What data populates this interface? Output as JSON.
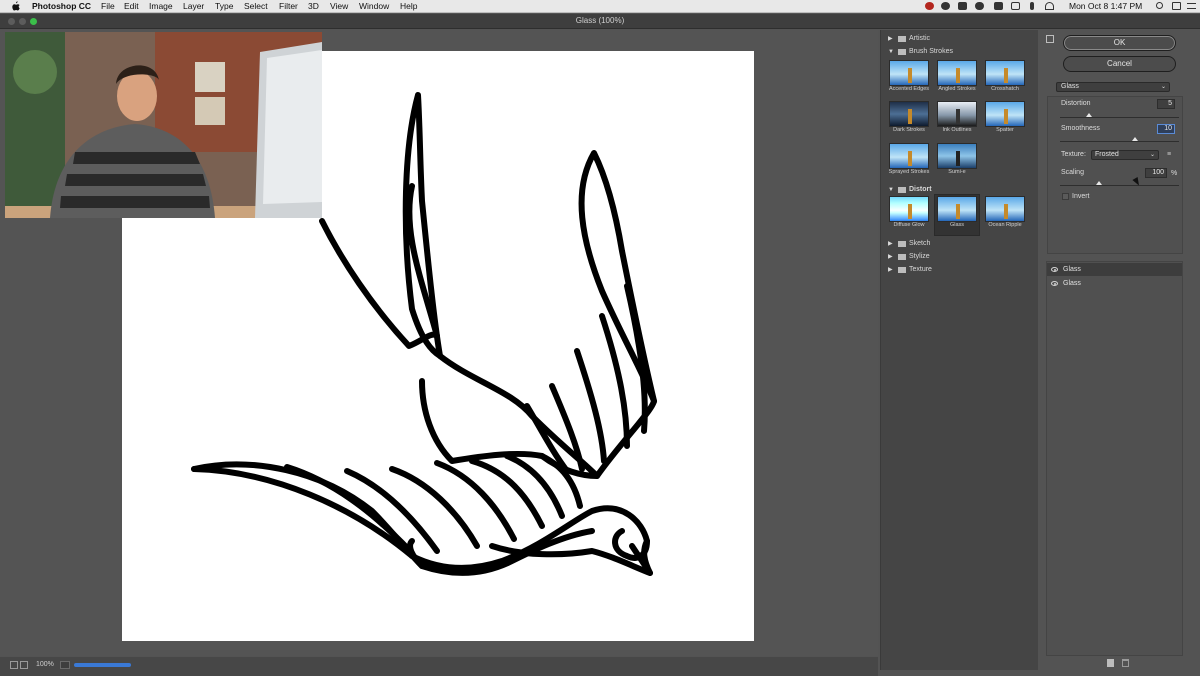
{
  "menubar": {
    "app_name": "Photoshop CC",
    "menus": [
      "File",
      "Edit",
      "Image",
      "Layer",
      "Type",
      "Select",
      "Filter",
      "3D",
      "View",
      "Window",
      "Help"
    ],
    "clock": "Mon Oct 8  1:47 PM"
  },
  "window": {
    "title": "Glass (100%)"
  },
  "status": {
    "zoom": "100%"
  },
  "gallery": {
    "folders": [
      {
        "label": "Artistic",
        "expanded": false
      },
      {
        "label": "Brush Strokes",
        "expanded": true
      },
      {
        "label": "Distort",
        "expanded": true
      },
      {
        "label": "Sketch",
        "expanded": false
      },
      {
        "label": "Stylize",
        "expanded": false
      },
      {
        "label": "Texture",
        "expanded": false
      }
    ],
    "brush_strokes": [
      "Accented Edges",
      "Angled Strokes",
      "Crosshatch",
      "Dark Strokes",
      "Ink Outlines",
      "Spatter",
      "Sprayed Strokes",
      "Sumi-e"
    ],
    "distort": [
      "Diffuse Glow",
      "Glass",
      "Ocean Ripple"
    ],
    "selected": "Glass"
  },
  "dialog": {
    "ok": "OK",
    "cancel": "Cancel",
    "filter": "Glass",
    "distortion_label": "Distortion",
    "distortion": "5",
    "smoothness_label": "Smoothness",
    "smoothness": "10",
    "texture_label": "Texture:",
    "texture": "Frosted",
    "scaling_label": "Scaling",
    "scaling": "100",
    "scaling_unit": "%",
    "invert_label": "Invert",
    "invert": false
  },
  "layers": [
    "Glass",
    "Glass"
  ]
}
